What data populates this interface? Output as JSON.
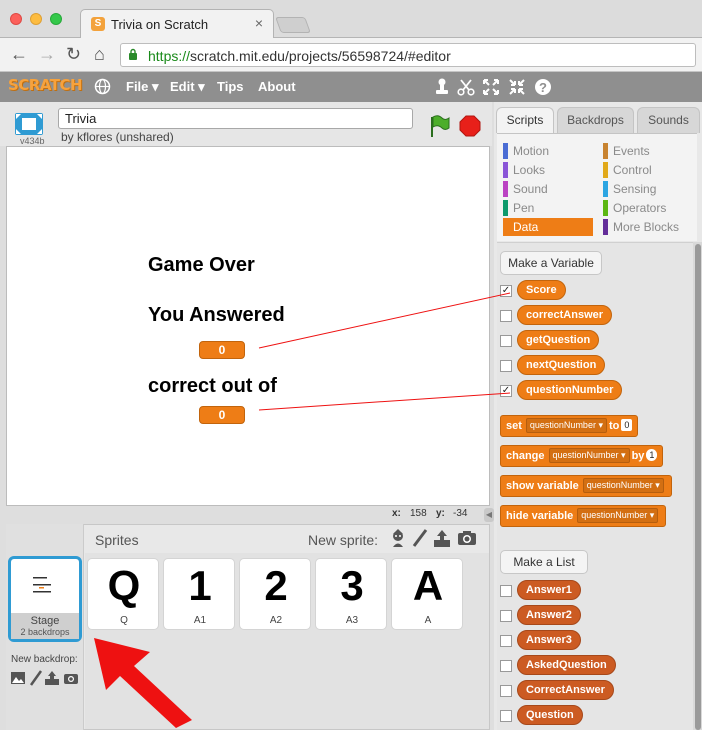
{
  "browser": {
    "tab_title": "Trivia on Scratch",
    "tab_close": "×",
    "url_scheme": "https://",
    "url_rest": "scratch.mit.edu/projects/56598724/#editor",
    "nav": {
      "back": "←",
      "forward": "→",
      "reload": "↻",
      "home": "⌂"
    }
  },
  "menubar": {
    "logo": "SCRATCH",
    "items": [
      "File ▾",
      "Edit ▾",
      "Tips",
      "About"
    ]
  },
  "stage_header": {
    "version": "v434b",
    "project_title": "Trivia",
    "byline": "by kflores (unshared)"
  },
  "stage": {
    "texts": [
      "Game Over",
      "You Answered",
      "correct out of"
    ],
    "monitor_values": [
      "0",
      "0"
    ],
    "coords": {
      "x_label": "x:",
      "x_value": "158",
      "y_label": "y:",
      "y_value": "-34"
    }
  },
  "sprite_pane": {
    "sprites_label": "Sprites",
    "new_sprite_label": "New sprite:",
    "stage_label": "Stage",
    "stage_backdrops": "2 backdrops",
    "new_backdrop_label": "New backdrop:",
    "sprites": [
      {
        "glyph": "Q",
        "name": "Q"
      },
      {
        "glyph": "1",
        "name": "A1"
      },
      {
        "glyph": "2",
        "name": "A2"
      },
      {
        "glyph": "3",
        "name": "A3"
      },
      {
        "glyph": "A",
        "name": "A"
      }
    ]
  },
  "palette": {
    "tabs": [
      "Scripts",
      "Backdrops",
      "Sounds"
    ],
    "categories_left": [
      "Motion",
      "Looks",
      "Sound",
      "Pen",
      "Data"
    ],
    "categories_right": [
      "Events",
      "Control",
      "Sensing",
      "Operators",
      "More Blocks"
    ],
    "make_variable": "Make a Variable",
    "variables": [
      {
        "name": "Score",
        "checked": "✓"
      },
      {
        "name": "correctAnswer",
        "checked": ""
      },
      {
        "name": "getQuestion",
        "checked": ""
      },
      {
        "name": "nextQuestion",
        "checked": ""
      },
      {
        "name": "questionNumber",
        "checked": "✓"
      }
    ],
    "set_block": {
      "kw": "set",
      "var": "questionNumber ▾",
      "to": "to",
      "val": "0"
    },
    "change_block": {
      "kw": "change",
      "var": "questionNumber ▾",
      "by": "by",
      "val": "1"
    },
    "show_block": {
      "kw": "show variable",
      "var": "questionNumber ▾"
    },
    "hide_block": {
      "kw": "hide variable",
      "var": "questionNumber ▾"
    },
    "make_list": "Make a List",
    "lists": [
      "Answer1",
      "Answer2",
      "Answer3",
      "AskedQuestion",
      "CorrectAnswer",
      "Question"
    ]
  },
  "colors": {
    "data_orange": "#ee7d16",
    "list_orange": "#cc5b22",
    "annotation_red": "#ee1111",
    "stage_selected_blue": "#2f9bd3"
  }
}
